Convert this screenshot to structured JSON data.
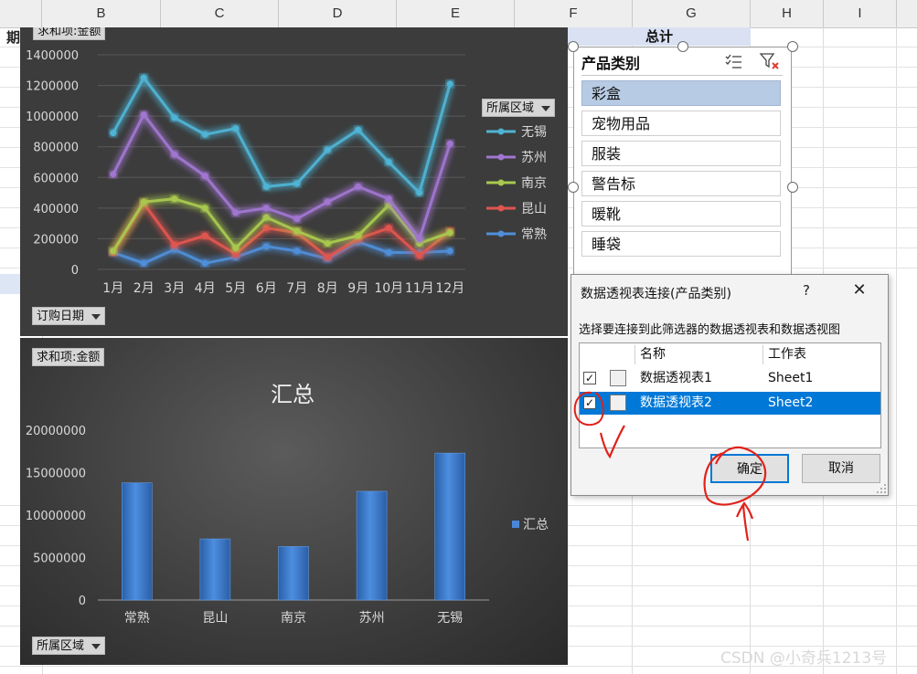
{
  "spreadsheet": {
    "columns": [
      {
        "label": "B"
      },
      {
        "label": "C"
      },
      {
        "label": "D"
      },
      {
        "label": "E"
      },
      {
        "label": "F"
      },
      {
        "label": "G"
      },
      {
        "label": "H"
      },
      {
        "label": "I"
      }
    ],
    "cell_qi": "期",
    "total_header": "总计"
  },
  "line_chart": {
    "value_field": "求和项:金额",
    "date_field": "订购日期",
    "region_field": "所属区域"
  },
  "bar_chart": {
    "value_field": "求和项:金额",
    "region_field": "所属区域"
  },
  "chart_data": [
    {
      "type": "line",
      "categories": [
        "1月",
        "2月",
        "3月",
        "4月",
        "5月",
        "6月",
        "7月",
        "8月",
        "9月",
        "10月",
        "11月",
        "12月"
      ],
      "ylim": [
        0,
        1400000
      ],
      "yticks": [
        "0",
        "200000",
        "400000",
        "600000",
        "800000",
        "1000000",
        "1200000",
        "1400000"
      ],
      "grid": true,
      "legend": "right",
      "series": [
        {
          "name": "无锡",
          "color": "#4fb3d4",
          "values": [
            890000,
            1250000,
            990000,
            880000,
            920000,
            540000,
            560000,
            780000,
            910000,
            700000,
            500000,
            1210000
          ]
        },
        {
          "name": "苏州",
          "color": "#a076d0",
          "values": [
            620000,
            1010000,
            750000,
            610000,
            370000,
            400000,
            330000,
            440000,
            540000,
            460000,
            200000,
            820000
          ]
        },
        {
          "name": "南京",
          "color": "#a8c84e",
          "values": [
            120000,
            440000,
            460000,
            400000,
            140000,
            340000,
            250000,
            170000,
            220000,
            420000,
            170000,
            240000
          ]
        },
        {
          "name": "昆山",
          "color": "#e0554f",
          "values": [
            110000,
            430000,
            160000,
            220000,
            100000,
            270000,
            240000,
            80000,
            200000,
            270000,
            90000,
            250000
          ]
        },
        {
          "name": "常熟",
          "color": "#4f8ed8",
          "values": [
            110000,
            40000,
            130000,
            40000,
            80000,
            150000,
            120000,
            70000,
            180000,
            110000,
            110000,
            120000
          ]
        }
      ]
    },
    {
      "type": "bar",
      "title": "汇总",
      "categories": [
        "常熟",
        "昆山",
        "南京",
        "苏州",
        "无锡"
      ],
      "series": [
        {
          "name": "汇总",
          "values": [
            13800000,
            7200000,
            6300000,
            12800000,
            17300000
          ]
        }
      ],
      "ylim": [
        0,
        20000000
      ],
      "yticks": [
        "0",
        "5000000",
        "10000000",
        "15000000",
        "20000000"
      ],
      "legend": "right"
    }
  ],
  "slicer": {
    "title": "产品类别",
    "items": [
      {
        "label": "彩盒",
        "selected": true
      },
      {
        "label": "宠物用品",
        "selected": false
      },
      {
        "label": "服装",
        "selected": false
      },
      {
        "label": "警告标",
        "selected": false
      },
      {
        "label": "暖靴",
        "selected": false
      },
      {
        "label": "睡袋",
        "selected": false
      }
    ]
  },
  "dialog": {
    "title": "数据透视表连接(产品类别)",
    "help": "?",
    "close": "✕",
    "prompt": "选择要连接到此筛选器的数据透视表和数据透视图",
    "headers": {
      "name": "名称",
      "sheet": "工作表"
    },
    "rows": [
      {
        "name": "数据透视表1",
        "sheet": "Sheet1",
        "checked": true,
        "mark": "✓"
      },
      {
        "name": "数据透视表2",
        "sheet": "Sheet2",
        "checked": true,
        "mark": "✓",
        "selected": true
      }
    ],
    "ok_label": "确定",
    "cancel_label": "取消"
  },
  "watermark": "CSDN @小奇兵1213号",
  "annotation_color": "#e0221a"
}
